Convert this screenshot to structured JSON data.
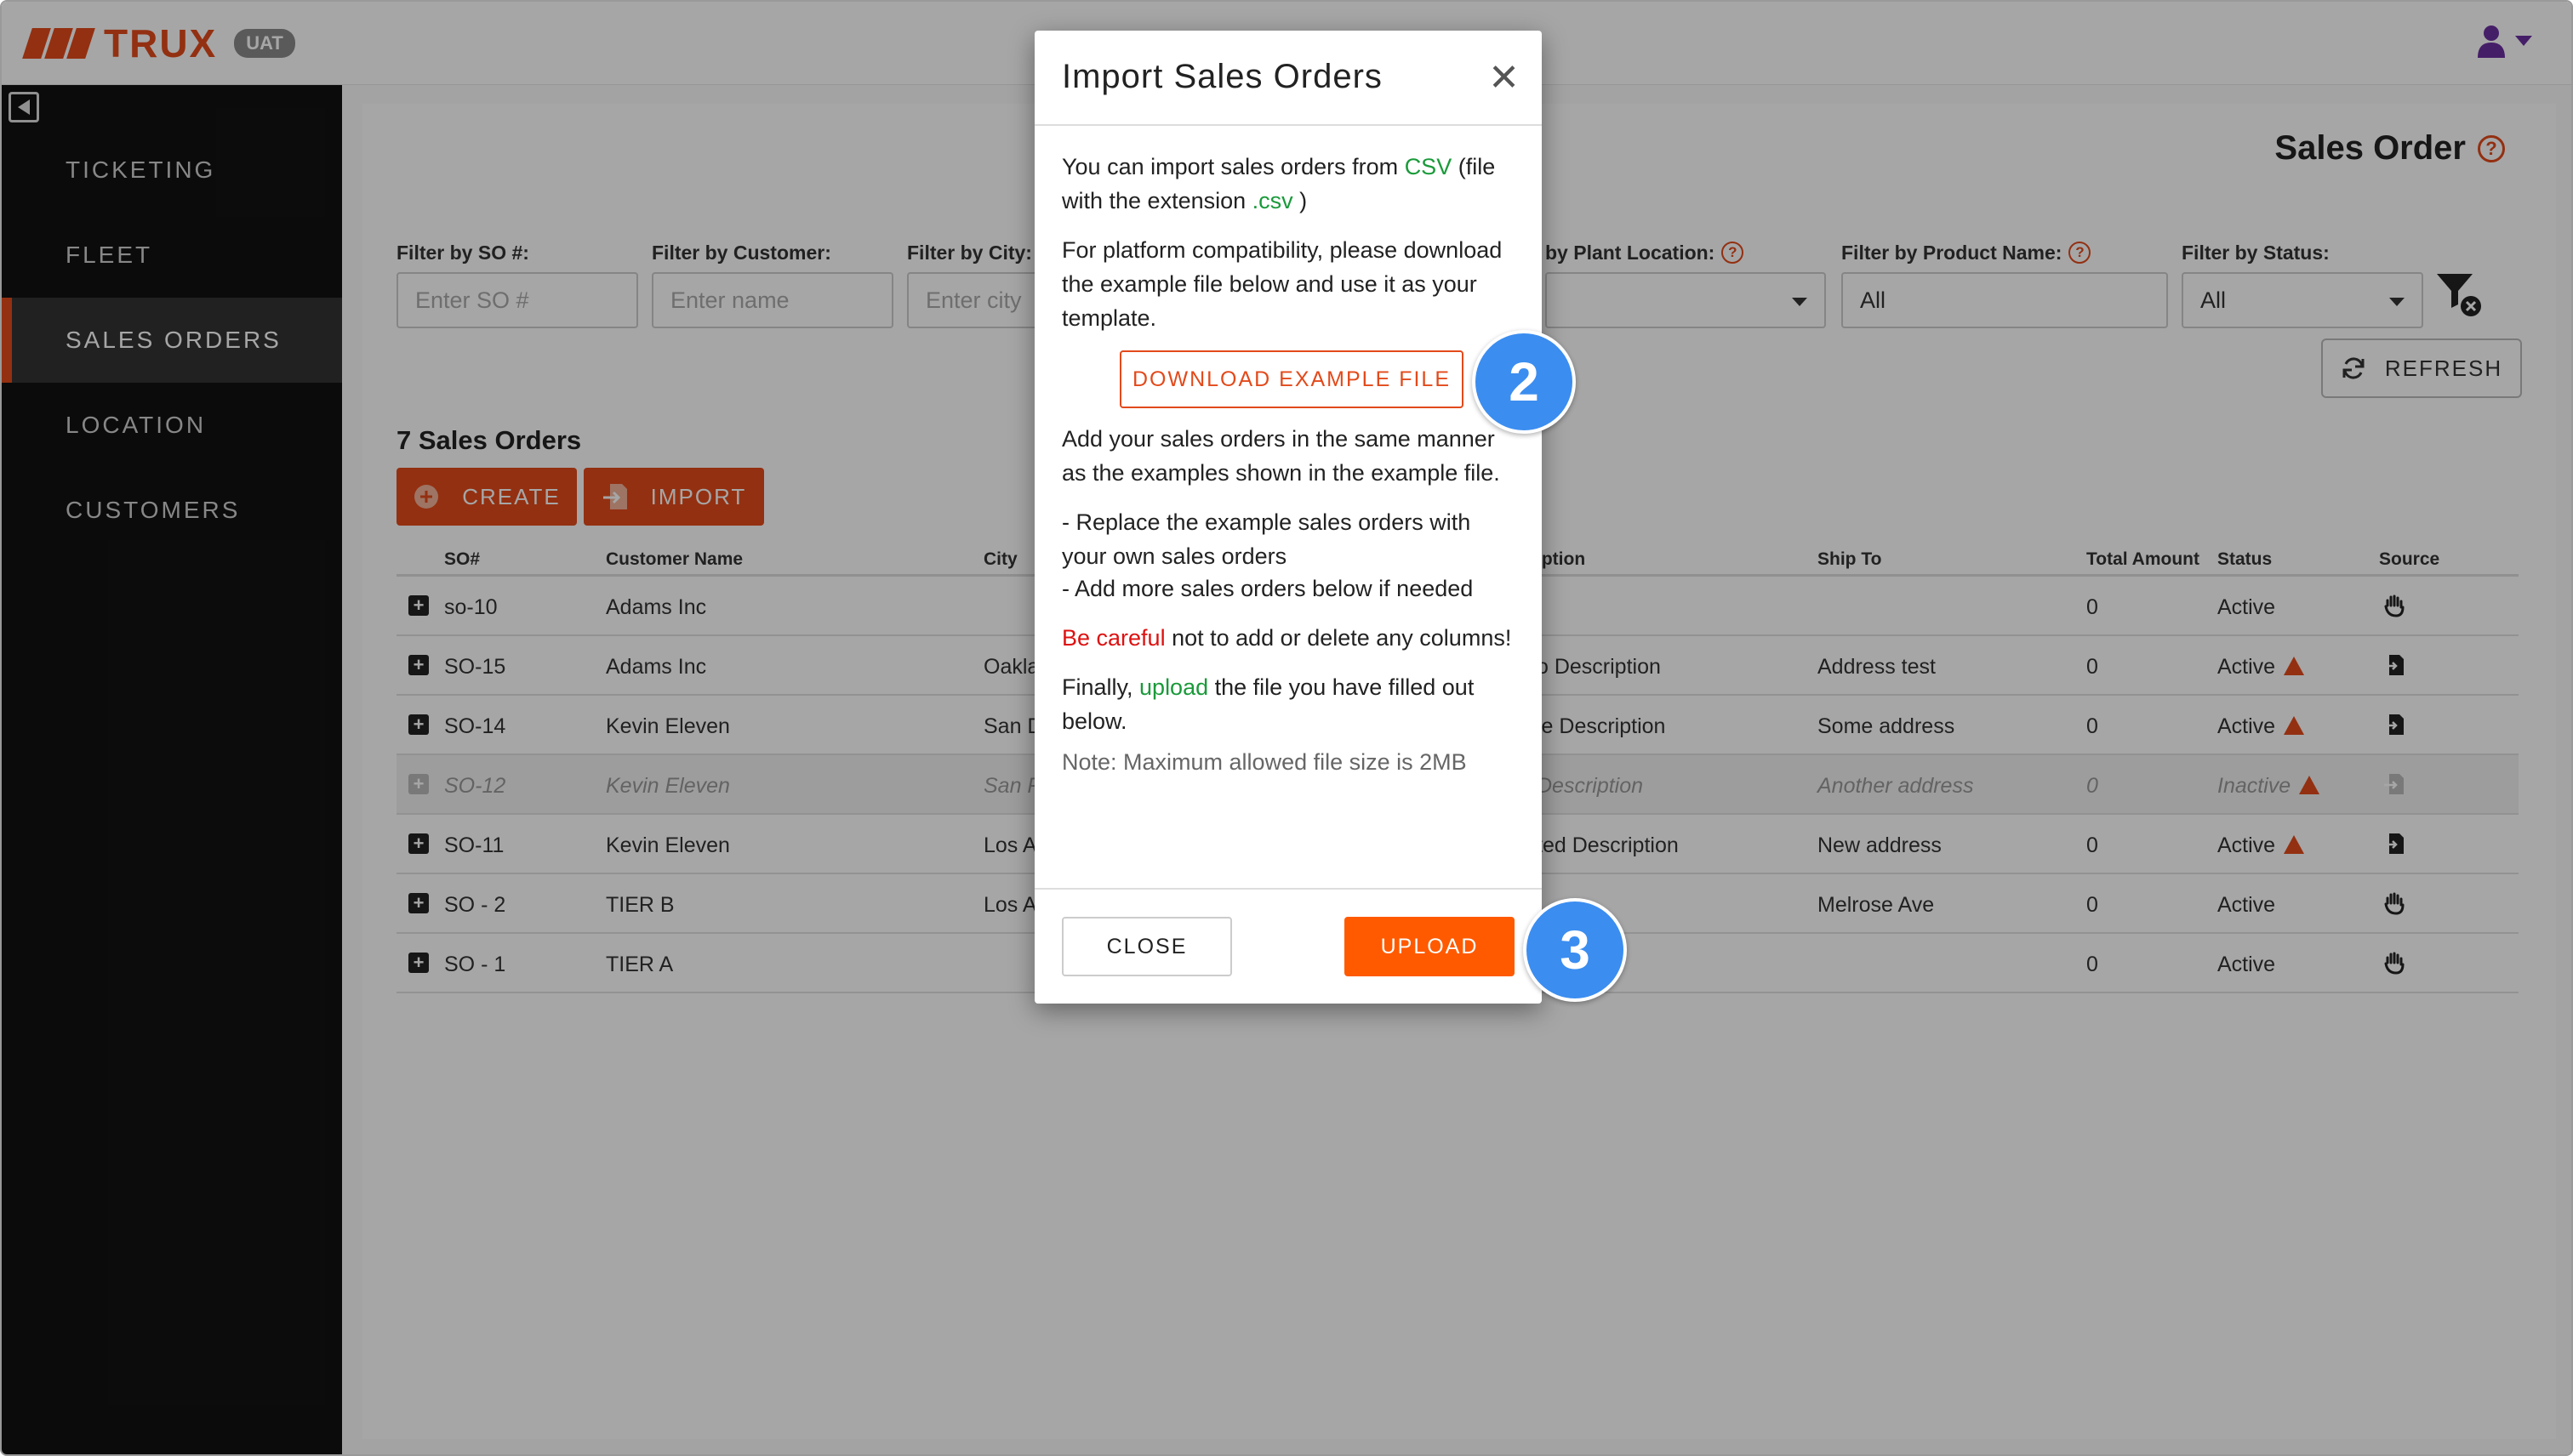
{
  "app": {
    "brand": "TRUX",
    "env_badge": "UAT"
  },
  "sidebar": {
    "items": [
      {
        "label": "TICKETING"
      },
      {
        "label": "FLEET"
      },
      {
        "label": "SALES ORDERS",
        "active": true
      },
      {
        "label": "LOCATION"
      },
      {
        "label": "CUSTOMERS"
      }
    ]
  },
  "page": {
    "title": "Sales Order"
  },
  "filters": {
    "so": {
      "label": "Filter by SO #:",
      "placeholder": "Enter SO #"
    },
    "customer": {
      "label": "Filter by Customer:",
      "placeholder": "Enter name"
    },
    "city": {
      "label": "Filter by City:",
      "placeholder": "Enter city"
    },
    "plant": {
      "label": "by Plant Location:",
      "value": ""
    },
    "product": {
      "label": "Filter by Product Name:",
      "value": "All"
    },
    "status": {
      "label": "Filter by Status:",
      "value": "All"
    }
  },
  "toolbar": {
    "refresh": "REFRESH",
    "count": "7 Sales Orders",
    "create": "CREATE",
    "import": "IMPORT"
  },
  "table": {
    "headers": {
      "so": "SO#",
      "customer": "Customer Name",
      "city": "City",
      "description": "iption",
      "ship_to": "Ship To",
      "total": "Total Amount",
      "status": "Status",
      "source": "Source"
    },
    "rows": [
      {
        "so": "so-10",
        "customer": "Adams Inc",
        "city": "",
        "description": "",
        "ship_to": "",
        "total": "0",
        "status": "Active"
      },
      {
        "so": "SO-15",
        "customer": "Adams Inc",
        "city": "Oakla",
        "description": "o Description",
        "ship_to": "Address test",
        "total": "0",
        "status": "Active"
      },
      {
        "so": "SO-14",
        "customer": "Kevin Eleven",
        "city": "San D",
        "description": "le Description",
        "ship_to": "Some address",
        "total": "0",
        "status": "Active"
      },
      {
        "so": "SO-12",
        "customer": "Kevin Eleven",
        "city": "San F",
        "description": "Description",
        "ship_to": "Another address",
        "total": "0",
        "status": "Inactive"
      },
      {
        "so": "SO-11",
        "customer": "Kevin Eleven",
        "city": "Los A",
        "description": "ted Description",
        "ship_to": "New address",
        "total": "0",
        "status": "Active"
      },
      {
        "so": "SO - 2",
        "customer": "TIER B",
        "city": "Los A",
        "description": "",
        "ship_to": "Melrose Ave",
        "total": "0",
        "status": "Active"
      },
      {
        "so": "SO - 1",
        "customer": "TIER A",
        "city": "",
        "description": "",
        "ship_to": "",
        "total": "0",
        "status": "Active"
      }
    ]
  },
  "modal": {
    "title": "Import Sales Orders",
    "p1_a": "You can import sales orders from ",
    "p1_csv": "CSV",
    "p1_b": " (file with the extension ",
    "p1_ext": ".csv",
    "p1_c": " )",
    "p2": "For platform compatibility, please download the example file below and use it as your template.",
    "download": "DOWNLOAD EXAMPLE FILE",
    "p3": "Add your sales orders in the same manner as the examples shown in the example file.",
    "li1": "-  Replace the example sales orders with your own sales orders",
    "li2": "-  Add more sales orders below if needed",
    "p4_red": "Be careful",
    "p4_rest": " not to add or delete any columns!",
    "p5_a": "Finally, ",
    "p5_green": "upload",
    "p5_b": " the file you have filled out below.",
    "note": "Note: Maximum allowed file size is 2MB",
    "close": "CLOSE",
    "upload": "UPLOAD"
  },
  "steps": {
    "download": "2",
    "upload": "3"
  },
  "colors": {
    "brand": "#e24a1b",
    "upload": "#ff5a00",
    "step": "#3b8df0",
    "green": "#1a9a3a"
  }
}
